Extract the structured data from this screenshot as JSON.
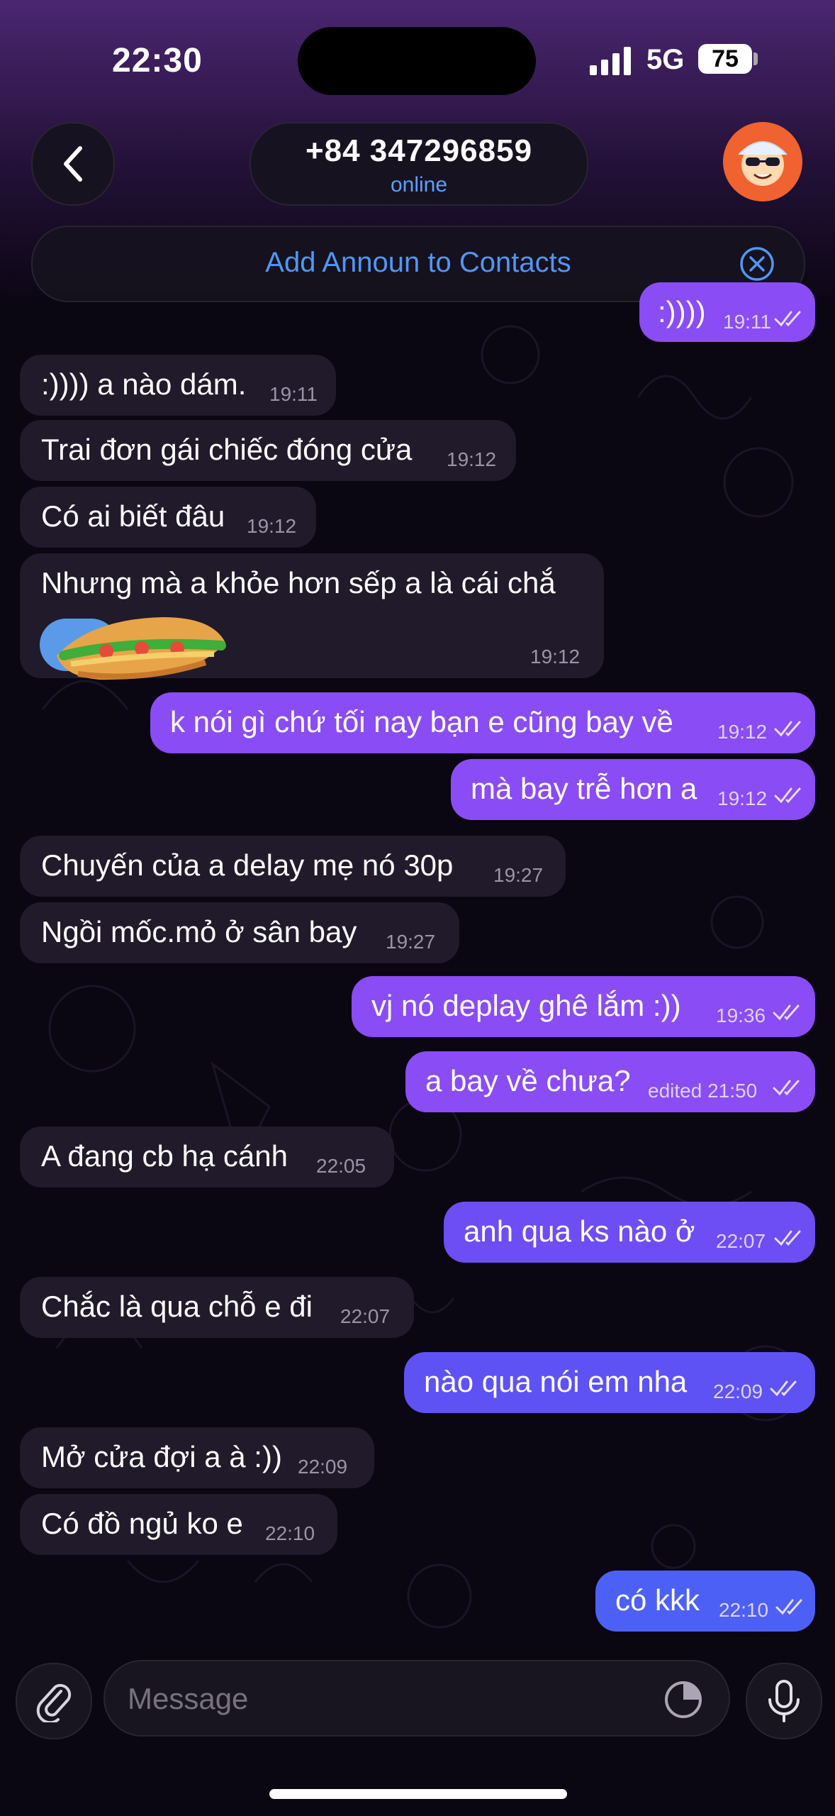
{
  "status_bar": {
    "time": "22:30",
    "network": "5G",
    "battery": "75"
  },
  "header": {
    "title": "+84 347296859",
    "subtitle": "online",
    "banner_label": "Add Announ to Contacts"
  },
  "messages": [
    {
      "dir": "out",
      "text": ":))))",
      "time": "19:11",
      "read": true
    },
    {
      "dir": "in",
      "text": ":)))) a nào dám.",
      "time": "19:11"
    },
    {
      "dir": "in",
      "text": "Trai đơn gái chiếc đóng cửa",
      "time": "19:12"
    },
    {
      "dir": "in",
      "text": "Có ai biết đâu",
      "time": "19:12"
    },
    {
      "dir": "in",
      "text": "Nhưng mà a khỏe hơn sếp a là cái chắ",
      "time": "19:12"
    },
    {
      "dir": "out",
      "text": "k nói gì chứ tối nay bạn e cũng bay về",
      "time": "19:12",
      "read": true
    },
    {
      "dir": "out",
      "text": "mà bay trễ hơn a",
      "time": "19:12",
      "read": true
    },
    {
      "dir": "in",
      "text": "Chuyến của a delay mẹ nó 30p",
      "time": "19:27"
    },
    {
      "dir": "in",
      "text": "Ngồi mốc.mỏ ở sân bay",
      "time": "19:27"
    },
    {
      "dir": "out",
      "text": "vj nó deplay ghê lắm :))",
      "time": "19:36",
      "read": true
    },
    {
      "dir": "out",
      "text": "a bay về chưa?",
      "time": "edited 21:50",
      "read": true
    },
    {
      "dir": "in",
      "text": "A đang cb hạ cánh",
      "time": "22:05"
    },
    {
      "dir": "out",
      "text": "anh qua ks nào ở",
      "time": "22:07",
      "read": true
    },
    {
      "dir": "in",
      "text": "Chắc là qua chỗ e đi",
      "time": "22:07"
    },
    {
      "dir": "out",
      "text": "nào qua nói em nha",
      "time": "22:09",
      "read": true
    },
    {
      "dir": "in",
      "text": "Mở cửa đợi a à :))",
      "time": "22:09"
    },
    {
      "dir": "in",
      "text": "Có đồ ngủ ko e",
      "time": "22:10"
    },
    {
      "dir": "out",
      "text": "có kkk",
      "time": "22:10",
      "read": true
    }
  ],
  "composer": {
    "placeholder": "Message"
  },
  "icons": {
    "back": "chevron-left-icon",
    "banner_close": "close-circle-icon",
    "attach": "paperclip-icon",
    "sticker": "sticker-icon",
    "mic": "microphone-icon",
    "read_receipt": "double-check-icon",
    "avatar": "cartoon-avatar",
    "sandwich": "banh-mi-emoji"
  },
  "colors": {
    "accent": "#4f97f5",
    "outgoing_bubble": "#8a4cf4",
    "outgoing_bubble_late": "#5b55f4",
    "incoming_bubble": "#221c2c"
  }
}
